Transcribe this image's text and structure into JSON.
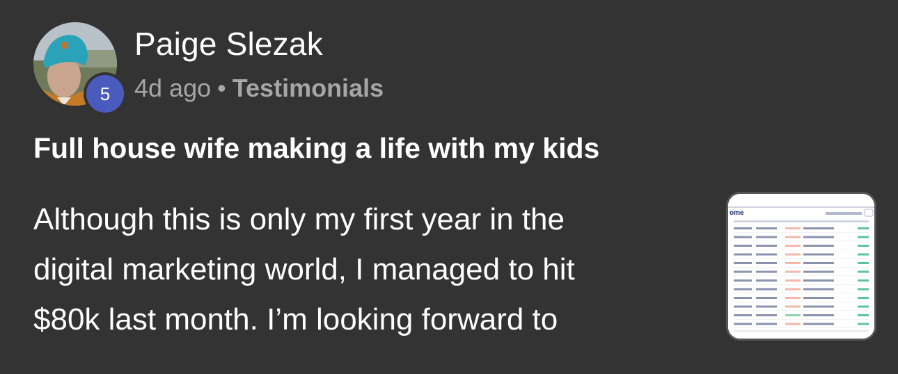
{
  "author": {
    "name": "Paige Slezak",
    "level": "5",
    "avatar_icon": "person-photo"
  },
  "meta": {
    "time": "4d ago",
    "separator": "•",
    "category": "Testimonials"
  },
  "post": {
    "title": "Full house wife making a life with my kids",
    "body_lines": [
      "Although this is only my first year in the",
      "digital marketing world, I managed to hit",
      "$80k last month. I’m looking forward to"
    ]
  },
  "thumbnail": {
    "icon": "sales-table-screenshot",
    "header_text": "ome"
  },
  "colors": {
    "background": "#333333",
    "badge": "#4a5bbd",
    "meta_text": "#a6a6a6"
  }
}
